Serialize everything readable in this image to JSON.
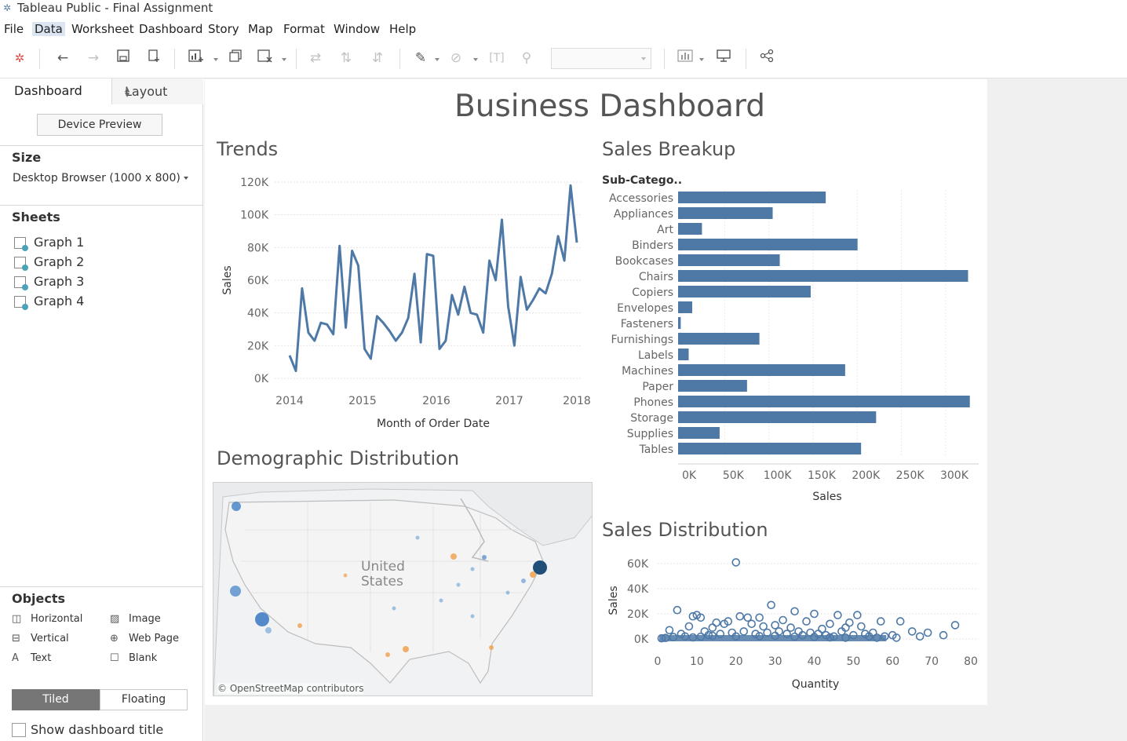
{
  "window": {
    "title": "Tableau Public - Final Assignment"
  },
  "menu": [
    "File",
    "Data",
    "Worksheet",
    "Dashboard",
    "Story",
    "Map",
    "Format",
    "Window",
    "Help"
  ],
  "menu_active": "Data",
  "toolbar": {
    "icons": [
      "tableau-logo-icon",
      "back-icon",
      "forward-icon",
      "save-icon",
      "new-datasource-icon",
      "new-worksheet-icon",
      "duplicate-icon",
      "clear-icon",
      "swap-icon",
      "sort-asc-icon",
      "sort-desc-icon",
      "highlight-icon",
      "paperclip-icon",
      "text-icon",
      "pin-icon",
      "show-me-icon",
      "presentation-icon",
      "share-icon"
    ]
  },
  "left_pane": {
    "tabs": {
      "dashboard": "Dashboard",
      "layout": "Layout"
    },
    "device_preview": "Device Preview",
    "size": {
      "heading": "Size",
      "value": "Desktop Browser (1000 x 800)"
    },
    "sheets": {
      "heading": "Sheets",
      "items": [
        "Graph 1",
        "Graph 2",
        "Graph 3",
        "Graph 4"
      ]
    },
    "objects": {
      "heading": "Objects",
      "items": [
        {
          "label": "Horizontal",
          "icon": "horizontal-icon"
        },
        {
          "label": "Image",
          "icon": "image-icon"
        },
        {
          "label": "Vertical",
          "icon": "vertical-icon"
        },
        {
          "label": "Web Page",
          "icon": "globe-icon"
        },
        {
          "label": "Text",
          "icon": "text-icon"
        },
        {
          "label": "Blank",
          "icon": "blank-icon"
        }
      ]
    },
    "tiled": "Tiled",
    "floating": "Floating",
    "show_title": "Show dashboard title"
  },
  "dashboard": {
    "title": "Business Dashboard",
    "trends_title": "Trends",
    "breakup_title": "Sales Breakup",
    "demo_title": "Demographic Distribution",
    "dist_title": "Sales Distribution",
    "map": {
      "country_label_1": "United",
      "country_label_2": "States",
      "attribution": "© OpenStreetMap contributors"
    }
  },
  "chart_data": [
    {
      "type": "line",
      "title": "Trends",
      "xlabel": "Month of Order Date",
      "ylabel": "Sales",
      "x_ticks": [
        "2014",
        "2015",
        "2016",
        "2017",
        "2018"
      ],
      "y_ticks": [
        "0K",
        "20K",
        "40K",
        "60K",
        "80K",
        "100K",
        "120K"
      ],
      "ylim": [
        0,
        120000
      ],
      "series": [
        {
          "values": [
            14000,
            4500,
            55000,
            28000,
            23000,
            34000,
            33000,
            27000,
            81000,
            31000,
            78000,
            69000,
            18000,
            12000,
            38000,
            34000,
            29000,
            23000,
            28000,
            37000,
            64000,
            22000,
            76000,
            75000,
            18000,
            23000,
            51000,
            39000,
            56000,
            40000,
            39000,
            28000,
            72000,
            60000,
            97000,
            44000,
            20000,
            62000,
            42000,
            48000,
            55000,
            52000,
            64000,
            87000,
            72000,
            118000,
            83000
          ]
        }
      ]
    },
    {
      "type": "bar",
      "title": "Sales Breakup",
      "orientation": "horizontal",
      "category_header": "Sub-Catego..",
      "xlabel": "Sales",
      "x_ticks": [
        "0K",
        "50K",
        "100K",
        "150K",
        "200K",
        "250K",
        "300K"
      ],
      "xlim": [
        0,
        340000
      ],
      "categories": [
        "Accessories",
        "Appliances",
        "Art",
        "Binders",
        "Bookcases",
        "Chairs",
        "Copiers",
        "Envelopes",
        "Fasteners",
        "Furnishings",
        "Labels",
        "Machines",
        "Paper",
        "Phones",
        "Storage",
        "Supplies",
        "Tables"
      ],
      "values": [
        167000,
        107000,
        27000,
        203000,
        115000,
        328000,
        150000,
        16000,
        3000,
        92000,
        12000,
        189000,
        78000,
        330000,
        224000,
        47000,
        207000
      ]
    },
    {
      "type": "scatter",
      "title": "Sales Distribution",
      "xlabel": "Quantity",
      "ylabel": "Sales",
      "x_ticks": [
        "0",
        "10",
        "20",
        "30",
        "40",
        "50",
        "60",
        "70",
        "80"
      ],
      "y_ticks": [
        "0K",
        "20K",
        "40K",
        "60K"
      ],
      "xlim": [
        0,
        80
      ],
      "ylim": [
        0,
        65000
      ],
      "points": [
        [
          20,
          61000
        ],
        [
          5,
          23000
        ],
        [
          29,
          27000
        ],
        [
          9,
          18000
        ],
        [
          11,
          17000
        ],
        [
          10,
          19000
        ],
        [
          21,
          18000
        ],
        [
          23,
          17000
        ],
        [
          26,
          17000
        ],
        [
          35,
          22000
        ],
        [
          40,
          20000
        ],
        [
          46,
          19000
        ],
        [
          51,
          19000
        ],
        [
          57,
          14000
        ],
        [
          62,
          14000
        ],
        [
          76,
          11000
        ],
        [
          69,
          5000
        ],
        [
          65,
          6000
        ],
        [
          73,
          3000
        ],
        [
          52,
          10000
        ],
        [
          49,
          13000
        ],
        [
          44,
          12000
        ],
        [
          48,
          9000
        ],
        [
          38,
          14000
        ],
        [
          42,
          8000
        ],
        [
          34,
          9000
        ],
        [
          27,
          10000
        ],
        [
          30,
          11000
        ],
        [
          17,
          12000
        ],
        [
          14,
          9000
        ],
        [
          8,
          10000
        ],
        [
          3,
          7000
        ],
        [
          6,
          4000
        ],
        [
          12,
          6000
        ],
        [
          15,
          13000
        ],
        [
          18,
          14000
        ],
        [
          24,
          12000
        ],
        [
          32,
          15000
        ],
        [
          36,
          6000
        ],
        [
          47,
          6000
        ],
        [
          53,
          4000
        ],
        [
          55,
          5000
        ],
        [
          60,
          3000
        ],
        [
          67,
          2000
        ],
        [
          4,
          1500
        ],
        [
          7,
          2000
        ],
        [
          13,
          3000
        ],
        [
          16,
          4000
        ],
        [
          19,
          5000
        ],
        [
          22,
          6000
        ],
        [
          25,
          4000
        ],
        [
          28,
          5000
        ],
        [
          31,
          6000
        ],
        [
          33,
          4000
        ],
        [
          37,
          3000
        ],
        [
          39,
          5000
        ],
        [
          41,
          4000
        ],
        [
          43,
          3000
        ],
        [
          45,
          2000
        ],
        [
          50,
          3000
        ],
        [
          54,
          2000
        ],
        [
          56,
          1000
        ],
        [
          58,
          2000
        ],
        [
          61,
          1000
        ],
        [
          1,
          500
        ],
        [
          2,
          800
        ],
        [
          9,
          1200
        ],
        [
          11,
          1800
        ],
        [
          14,
          2500
        ],
        [
          20,
          2000
        ],
        [
          26,
          2200
        ],
        [
          30,
          2500
        ],
        [
          35,
          1800
        ],
        [
          40,
          1500
        ],
        [
          44,
          1200
        ],
        [
          48,
          1000
        ]
      ]
    }
  ]
}
